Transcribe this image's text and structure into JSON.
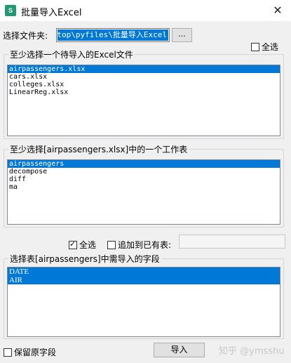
{
  "window": {
    "title": "批量导入Excel",
    "app_icon": "S",
    "close": "✕"
  },
  "folder": {
    "label": "选择文件夹:",
    "value": "sktop\\pyfiles\\批量导入Excel",
    "browse_label": "..."
  },
  "select_all_files": {
    "label": "全选",
    "checked": false
  },
  "files": {
    "group_title": "至少选择一个待导入的Excel文件",
    "items": [
      "airpassengers.xlsx",
      "cars.xlsx",
      "colleges.xlsx",
      "LinearReg.xlsx"
    ],
    "selected_index": 0
  },
  "sheets": {
    "group_title": "至少选择[airpassengers.xlsx]中的一个工作表",
    "items": [
      "airpassengers",
      "decompose",
      "diff",
      "ma"
    ],
    "selected_index": 0
  },
  "select_all_sheets": {
    "label": "全选",
    "checked": true
  },
  "append_existing": {
    "label": "追加到已有表:",
    "checked": false,
    "value": ""
  },
  "fields": {
    "group_title": "选择表[airpassengers]中需导入的字段",
    "items": [
      "DATE",
      "AIR"
    ],
    "selected": [
      0,
      1
    ]
  },
  "keep_original_fields": {
    "label": "保留原字段",
    "checked": false
  },
  "import_button": "导入",
  "watermark": "知乎 @ymsshu"
}
